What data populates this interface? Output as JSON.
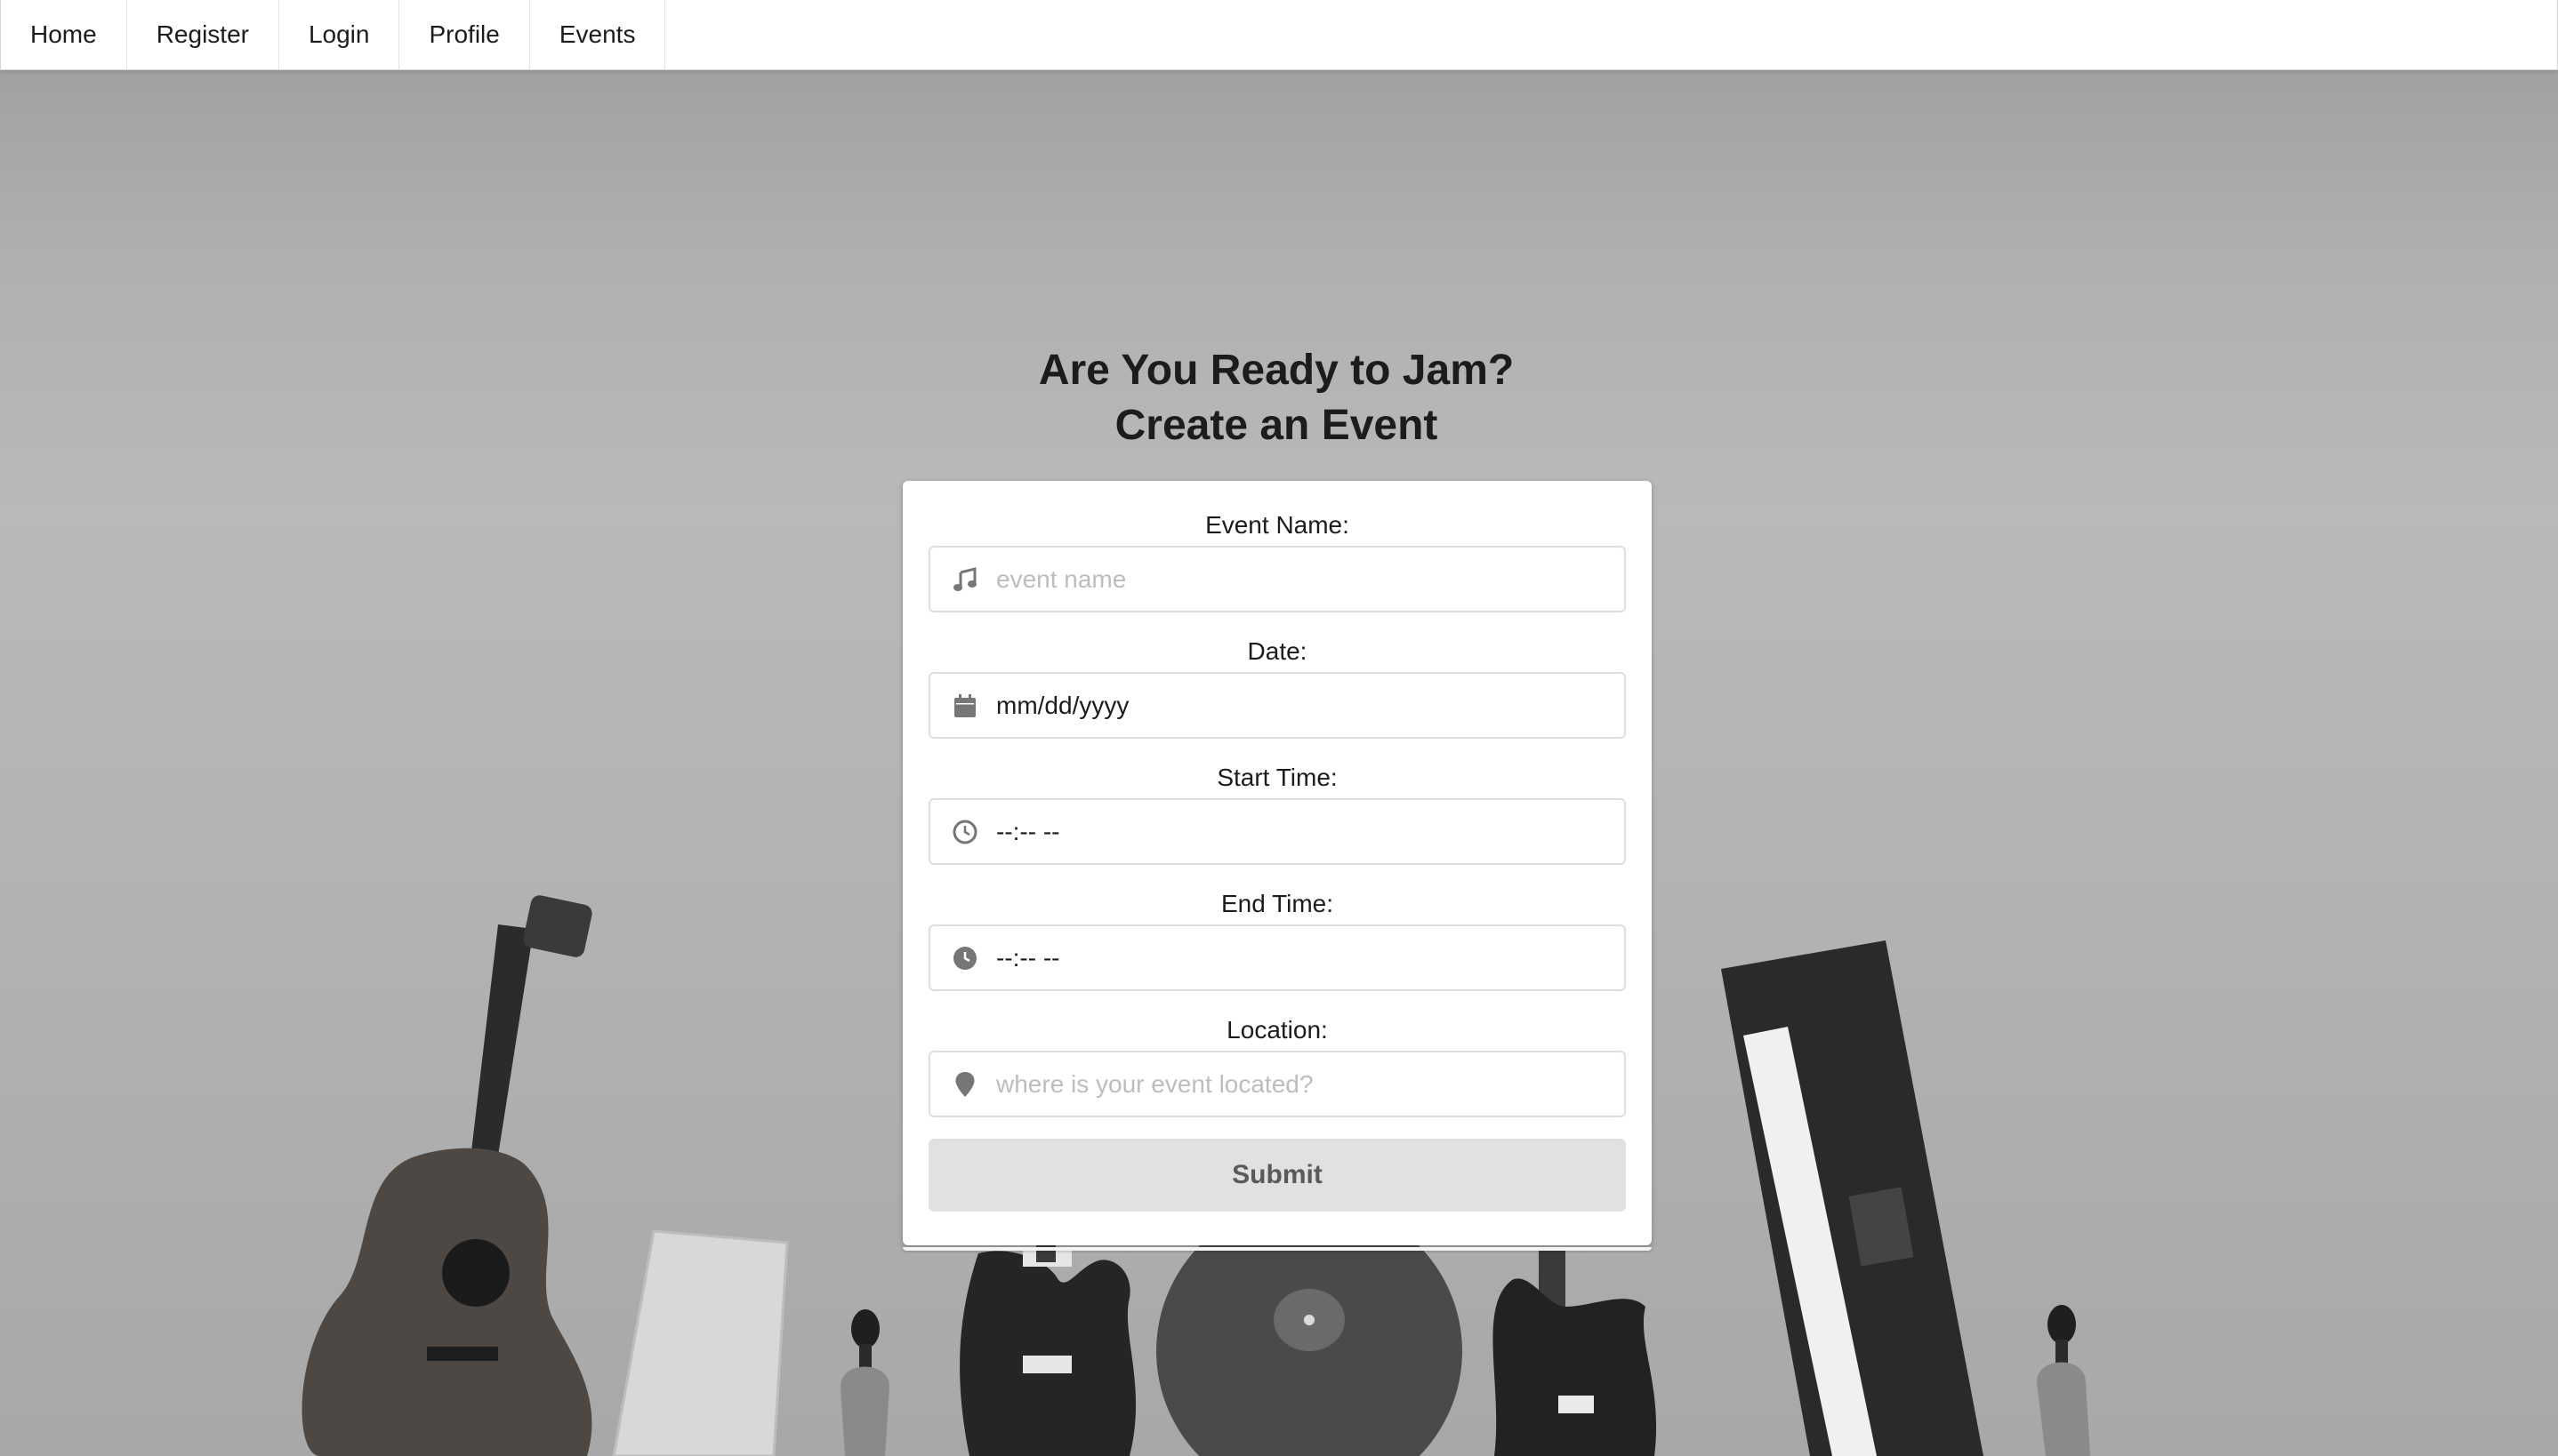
{
  "nav": {
    "items": [
      {
        "label": "Home"
      },
      {
        "label": "Register"
      },
      {
        "label": "Login"
      },
      {
        "label": "Profile"
      },
      {
        "label": "Events"
      }
    ]
  },
  "hero": {
    "line1": "Are You Ready to Jam?",
    "line2": "Create an Event"
  },
  "form": {
    "event_name": {
      "label": "Event Name:",
      "placeholder": "event name",
      "icon": "music-note-icon"
    },
    "date": {
      "label": "Date:",
      "value": "mm/dd/yyyy",
      "icon": "calendar-icon"
    },
    "start_time": {
      "label": "Start Time:",
      "value": "--:-- --",
      "icon": "clock-outline-icon"
    },
    "end_time": {
      "label": "End Time:",
      "value": "--:-- --",
      "icon": "clock-filled-icon"
    },
    "location": {
      "label": "Location:",
      "placeholder": "where is your event located?",
      "icon": "map-marker-icon"
    },
    "submit_label": "Submit"
  },
  "colors": {
    "icon": "#767676",
    "button_bg": "#e0e1e2",
    "button_text": "#5a5a5a"
  }
}
